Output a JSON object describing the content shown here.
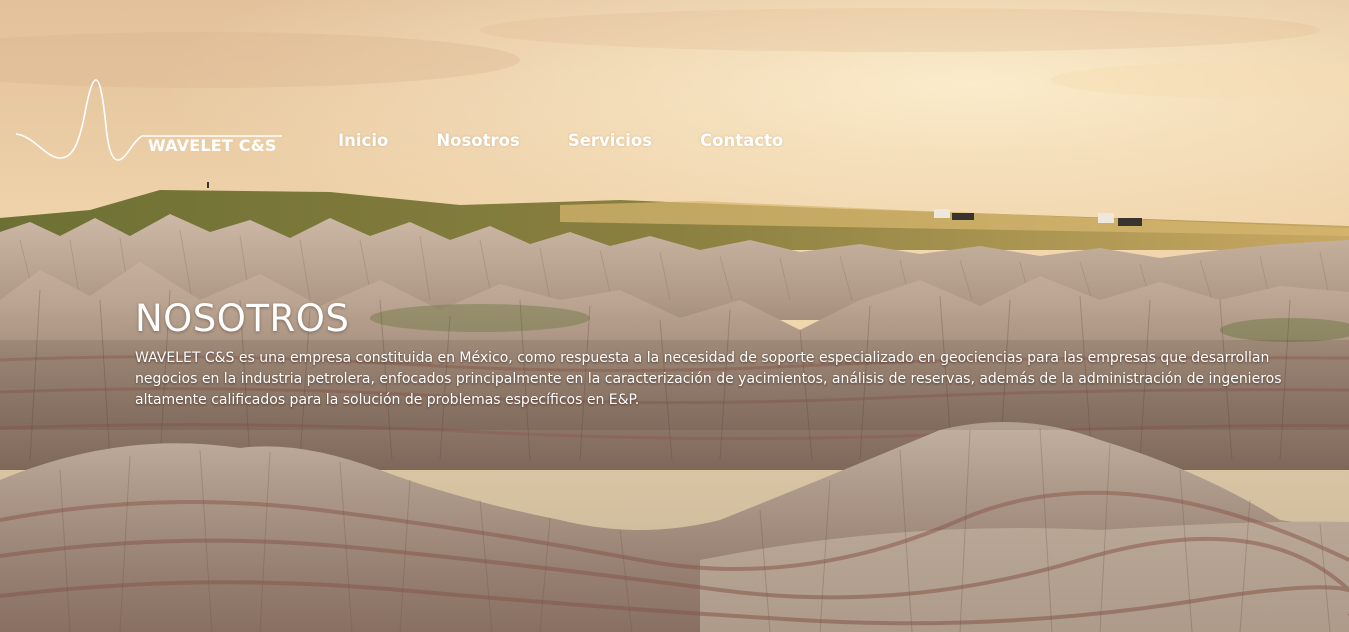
{
  "brand": {
    "name": "WAVELET C&S",
    "logo_icon": "wavelet-waveform-icon"
  },
  "nav": {
    "items": [
      {
        "label": "Inicio"
      },
      {
        "label": "Nosotros"
      },
      {
        "label": "Servicios"
      },
      {
        "label": "Contacto"
      }
    ]
  },
  "section": {
    "title": "NOSOTROS",
    "body": "WAVELET C&S es una empresa constituida en México, como respuesta a la necesidad de soporte especializado en geociencias para las empresas que desarrollan negocios en la industria petrolera, enfocados principalmente en la caracterización de yacimientos, análisis de reservas, además de la administración de ingenieros altamente calificados para la solución de problemas específicos en E&P."
  },
  "colors": {
    "sky_top": "#e8c9a0",
    "sky_glow": "#f7e2b8",
    "grass": "#7f7a3a",
    "rock": "#b8a493",
    "rock_band": "#a26b5c",
    "text": "#ffffff"
  }
}
